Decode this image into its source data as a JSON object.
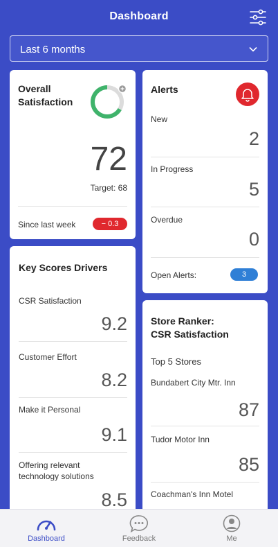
{
  "header": {
    "title": "Dashboard"
  },
  "period": {
    "selected": "Last 6 months"
  },
  "satisfaction": {
    "title_line1": "Overall",
    "title_line2": "Satisfaction",
    "score": "72",
    "target": "Target: 68",
    "since_label": "Since last week",
    "change": "− 0.3",
    "colors": {
      "ring": "#3fb36b",
      "ring_track": "#dcdcdc",
      "change_badge": "#e0282e"
    }
  },
  "alerts": {
    "title": "Alerts",
    "items": [
      {
        "label": "New",
        "value": "2"
      },
      {
        "label": "In Progress",
        "value": "5"
      },
      {
        "label": "Overdue",
        "value": "0"
      }
    ],
    "open_label": "Open Alerts:",
    "open_count": "3",
    "colors": {
      "bell_badge": "#e0282e",
      "open_pill": "#2f7fd6"
    }
  },
  "drivers": {
    "title": "Key Scores Drivers",
    "items": [
      {
        "label": "CSR Satisfaction",
        "value": "9.2"
      },
      {
        "label": "Customer Effort",
        "value": "8.2"
      },
      {
        "label": "Make it Personal",
        "value": "9.1"
      },
      {
        "label_line1": "Offering relevant",
        "label_line2": "technology solutions",
        "value": "8.5"
      }
    ]
  },
  "ranker": {
    "title_line1": "Store Ranker:",
    "title_line2": "CSR Satisfaction",
    "subtitle": "Top 5 Stores",
    "items": [
      {
        "label": "Bundabert City Mtr. Inn",
        "value": "87"
      },
      {
        "label": "Tudor Motor Inn",
        "value": "85"
      },
      {
        "label": "Coachman's Inn Motel"
      }
    ]
  },
  "tabs": [
    {
      "label": "Dashboard",
      "icon": "gauge-icon"
    },
    {
      "label": "Feedback",
      "icon": "chat-bubble-icon"
    },
    {
      "label": "Me",
      "icon": "user-icon"
    }
  ],
  "theme": {
    "primary": "#3b4cc6",
    "tab_active": "#3b4cc6"
  }
}
